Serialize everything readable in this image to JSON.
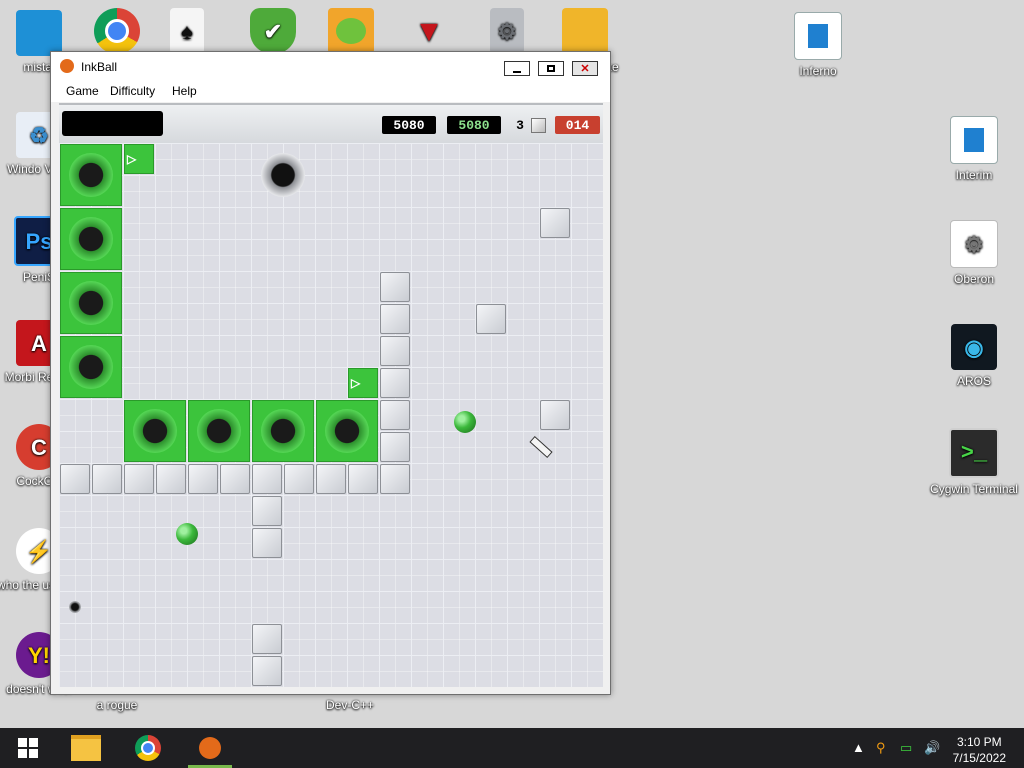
{
  "desktop_left": [
    {
      "label": "mistal",
      "icon": "monitor-icon"
    },
    {
      "label": "Windo Vista",
      "icon": "recycle-bin-icon"
    },
    {
      "label": "PeniS",
      "icon": "photoshop-icon"
    },
    {
      "label": "Morbi Reade",
      "icon": "acrobat-icon"
    },
    {
      "label": "CockCle",
      "icon": "ccleaner-icon"
    },
    {
      "label": "who the uses th",
      "icon": "lightning-icon"
    },
    {
      "label": "doesn't w lol",
      "icon": "yahoo-messenger-icon"
    }
  ],
  "desktop_top": [
    {
      "label": "",
      "icon": "chrome-icon"
    },
    {
      "label": "",
      "icon": "solitaire-icon"
    },
    {
      "label": "",
      "icon": "shield-check-icon"
    },
    {
      "label": "",
      "icon": "bad-piggies-icon"
    },
    {
      "label": "",
      "icon": "antivirus-icon"
    },
    {
      "label": "",
      "icon": "settings-file-icon"
    },
    {
      "label": "xe",
      "icon": "package-icon"
    }
  ],
  "desktop_right": [
    {
      "label": "Inferno",
      "icon": "window-icon"
    },
    {
      "label": "Interim",
      "icon": "window-icon"
    },
    {
      "label": "Oberon",
      "icon": "gears-icon"
    },
    {
      "label": "AROS",
      "icon": "aros-eye-icon"
    },
    {
      "label": "Cygwin Terminal",
      "icon": "terminal-icon"
    }
  ],
  "desktop_bottom": [
    {
      "label": "a rogue"
    },
    {
      "label": "Dev-C++"
    }
  ],
  "window": {
    "title": "InkBall",
    "menu": [
      "Game",
      "Difficulty",
      "Help"
    ]
  },
  "game": {
    "score": "5080",
    "high_score": "5080",
    "balls_remaining": "3",
    "timer": "014"
  },
  "taskbar": {
    "time": "3:10 PM",
    "date": "7/15/2022"
  },
  "colors": {
    "board": "#dcdde4",
    "green": "#3cc43c",
    "timer_bg": "#c8402f",
    "taskbar": "#1f1f22"
  }
}
